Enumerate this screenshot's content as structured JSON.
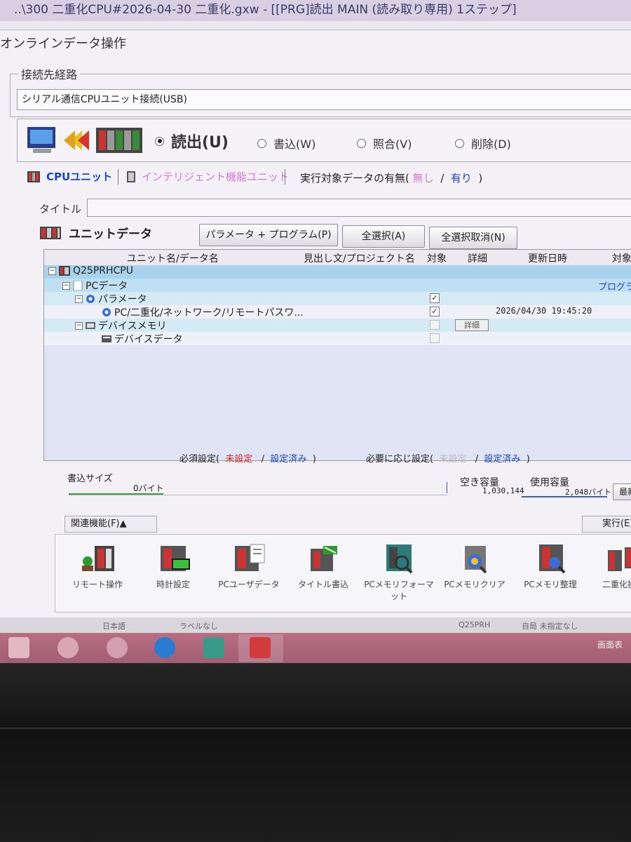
{
  "window": {
    "title": "..\\300 二重化CPU#2026-04-30 二重化.gxw - [[PRG]読出 MAIN (読み取り専用) 1ステップ]"
  },
  "dialog": {
    "title": "オンラインデータ操作",
    "route_group_label": "接続先経路",
    "route_value": "シリアル通信CPUユニット接続(USB)",
    "modes": [
      {
        "label": "読出(U)",
        "selected": true
      },
      {
        "label": "書込(W)",
        "selected": false
      },
      {
        "label": "照合(V)",
        "selected": false
      },
      {
        "label": "削除(D)",
        "selected": false
      }
    ],
    "tabs": [
      {
        "label": "CPUユニット",
        "active": true
      },
      {
        "label": "インテリジェント機能ユニット",
        "active": false
      }
    ],
    "exists_label": "実行対象データの有無(",
    "exists_none": "無し",
    "exists_slash": "/",
    "exists_yes": "有り",
    "exists_close": ")",
    "title_label": "タイトル",
    "unit_data_label": "ユニットデータ",
    "buttons": {
      "param_prog": "パラメータ + プログラム(P)",
      "select_all": "全選択(A)",
      "deselect_all": "全選択取消(N)"
    },
    "table": {
      "headers": {
        "name": "ユニット名/データ名",
        "caption": "見出し文/プロジェクト名",
        "target": "対象",
        "detail": "詳細",
        "updated": "更新日時",
        "target2": "対象"
      },
      "rows": [
        {
          "name": "Q25PRHCPU",
          "level": 0,
          "checked": null,
          "date": "",
          "extra": ""
        },
        {
          "name": "PCデータ",
          "level": 1,
          "checked": null,
          "date": "",
          "extra": "プログラム"
        },
        {
          "name": "パラメータ",
          "level": 2,
          "checked": true,
          "date": "",
          "extra": ""
        },
        {
          "name": "PC/二重化/ネットワーク/リモートパスワ...",
          "level": 3,
          "checked": true,
          "date": "2026/04/30 19:45:20",
          "extra": ""
        },
        {
          "name": "デバイスメモリ",
          "level": 2,
          "checked": false,
          "date": "",
          "extra": "",
          "detail": "詳細"
        },
        {
          "name": "デバイスデータ",
          "level": 3,
          "checked": false,
          "date": "",
          "extra": ""
        }
      ]
    },
    "legend": {
      "required": "必須設定(",
      "not_set": "未設定",
      "slash": "/",
      "set_done": "設定済み",
      "close": ")",
      "optional": "必要に応じ設定(",
      "optional_not_set": "未設定",
      "optional_set_done": "設定済み"
    },
    "write_size_label": "書込サイズ",
    "write_size_value": "0バイト",
    "free_label": "空き容量",
    "free_value": "1,030,144",
    "used_label": "使用容量",
    "used_value": "2,048バイト",
    "max_label": "最新",
    "related_label": "関連機能(F)▲",
    "execute_label": "実行(E)",
    "functions": [
      "リモート操作",
      "時計設定",
      "PCユーザデータ",
      "タイトル書込",
      "PCメモリフォーマット",
      "PCメモリクリア",
      "PCメモリ整理",
      "二重化操作"
    ]
  },
  "statusbar": {
    "lang": "日本語",
    "label": "ラベルなし",
    "cpu": "Q25PRH",
    "station": "自局 未指定なし"
  },
  "taskbar": {
    "tray_text": "画面表"
  },
  "colors": {
    "accent_blue": "#1a44c8",
    "not_set_red": "#dd2222",
    "inactive_pink": "#d07ad7",
    "tree_row_highlight": "#a9d3ec"
  }
}
